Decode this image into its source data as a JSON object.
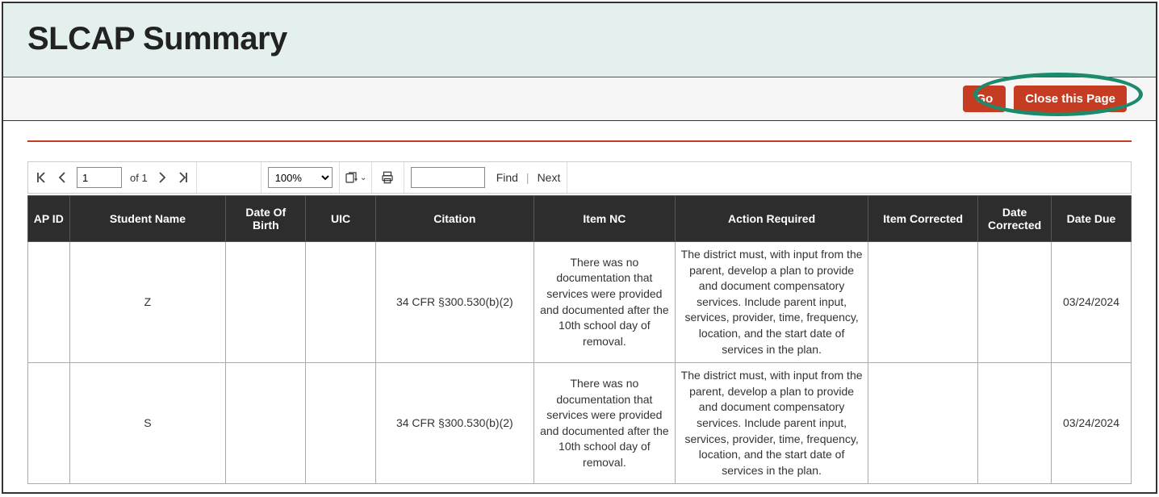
{
  "page_title": "SLCAP Summary",
  "buttons": {
    "go": "Go",
    "close": "Close this Page"
  },
  "toolbar": {
    "page_current": "1",
    "page_of_label": "of 1",
    "zoom": "100%",
    "find_label": "Find",
    "next_label": "Next"
  },
  "columns": {
    "apid": "AP ID",
    "name": "Student Name",
    "dob": "Date Of Birth",
    "uic": "UIC",
    "citation": "Citation",
    "item_nc": "Item NC",
    "action": "Action Required",
    "item_corr": "Item Corrected",
    "date_corr": "Date Corrected",
    "date_due": "Date Due"
  },
  "rows": [
    {
      "apid": "",
      "name": "Z",
      "dob": "",
      "uic": "",
      "citation": "34 CFR §300.530(b)(2)",
      "item_nc": "There was no documentation that services were provided and documented after the 10th school day of removal.",
      "action": "The district must, with input from the parent, develop a plan to provide and document compensatory services. Include parent input, services, provider, time, frequency, location, and the start date of services in the plan.",
      "item_corr": "",
      "date_corr": "",
      "date_due": "03/24/2024"
    },
    {
      "apid": "",
      "name": "S",
      "dob": "",
      "uic": "",
      "citation": "34 CFR §300.530(b)(2)",
      "item_nc": "There was no documentation that services were provided and documented after the 10th school day of removal.",
      "action": "The district must, with input from the parent, develop a plan to provide and document compensatory services. Include parent input, services, provider, time, frequency, location, and the start date of services in the plan.",
      "item_corr": "",
      "date_corr": "",
      "date_due": "03/24/2024"
    }
  ]
}
